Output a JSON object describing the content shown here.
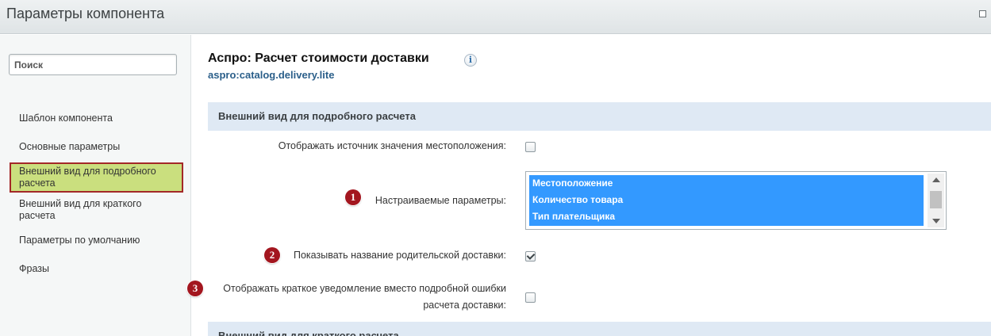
{
  "window": {
    "title": "Параметры компонента"
  },
  "sidebar": {
    "search_placeholder": "Поиск",
    "items": [
      {
        "label": "Шаблон компонента",
        "active": false
      },
      {
        "label": "Основные параметры",
        "active": false
      },
      {
        "label": "Внешний вид для подробного расчета",
        "active": true
      },
      {
        "label": "Внешний вид для краткого расчета",
        "active": false
      },
      {
        "label": "Параметры по умолчанию",
        "active": false
      },
      {
        "label": "Фразы",
        "active": false
      }
    ]
  },
  "component": {
    "title": "Аспро: Расчет стоимости доставки",
    "info_icon": "i",
    "code": "aspro:catalog.delivery.lite"
  },
  "sections": [
    {
      "title": "Внешний вид для подробного расчета"
    },
    {
      "title": "Внешний вид для краткого расчета"
    }
  ],
  "params": {
    "show_location_source": {
      "label": "Отображать источник значения местоположения:",
      "checked": false
    },
    "custom_params": {
      "label": "Настраиваемые параметры:",
      "marker": "1",
      "options": [
        "Местоположение",
        "Количество товара",
        "Тип плательщика"
      ]
    },
    "show_parent_delivery": {
      "label": "Показывать название родительской доставки:",
      "marker": "2",
      "checked": true
    },
    "short_notice": {
      "label_line1": "Отображать краткое уведомление вместо подробной ошибки",
      "label_line2": "расчета доставки:",
      "marker": "3",
      "checked": false
    }
  },
  "colors": {
    "accent_selected": "#3399ff",
    "active_nav_bg": "#cadf7e",
    "active_nav_border": "#a32828",
    "marker": "#a3161f"
  }
}
